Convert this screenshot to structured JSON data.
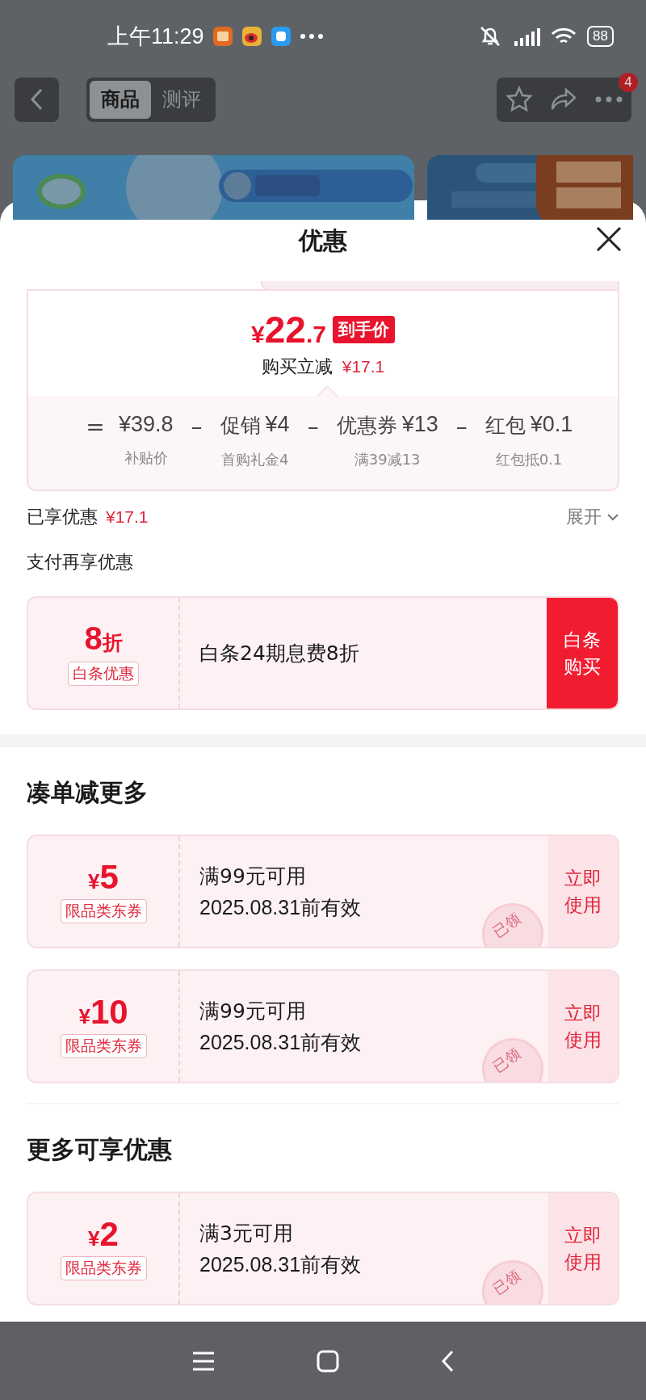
{
  "status_bar": {
    "time": "上午11:29",
    "battery": "88"
  },
  "nav": {
    "tabs": [
      {
        "label": "商品",
        "selected": true
      },
      {
        "label": "测评",
        "selected": false
      }
    ],
    "badge": "4"
  },
  "sheet": {
    "title": "优惠"
  },
  "price": {
    "currency": "¥",
    "integer": "22",
    "decimal": ".7",
    "tag": "到手价",
    "instant_label": "购买立减",
    "instant_amount": "¥17.1"
  },
  "breakdown": [
    {
      "op": "=",
      "amount": "¥39.8",
      "note": "补贴价"
    },
    {
      "op": "–",
      "label": "促销",
      "amount": "¥4",
      "note": "首购礼金4"
    },
    {
      "op": "–",
      "label": "优惠券",
      "amount": "¥13",
      "note": "满39减13"
    },
    {
      "op": "–",
      "label": "红包",
      "amount": "¥0.1",
      "note": "红包抵0.1"
    }
  ],
  "enjoyed": {
    "label": "已享优惠",
    "amount": "¥17.1",
    "expand": "展开"
  },
  "pay": {
    "title": "支付再享优惠",
    "value": "8",
    "unit": "折",
    "tag": "白条优惠",
    "desc": "白条24期息费8折",
    "button": "白条购买"
  },
  "sections": [
    {
      "title": "凑单减更多",
      "coupons": [
        {
          "currency": "¥",
          "amount": "5",
          "tag": "限品类东券",
          "condition": "满99元可用",
          "validity": "2025.08.31前有效",
          "action": "立即使用",
          "stamp": "已领"
        },
        {
          "currency": "¥",
          "amount": "10",
          "tag": "限品类东券",
          "condition": "满99元可用",
          "validity": "2025.08.31前有效",
          "action": "立即使用",
          "stamp": "已领"
        }
      ]
    },
    {
      "title": "更多可享优惠",
      "coupons": [
        {
          "currency": "¥",
          "amount": "2",
          "tag": "限品类东券",
          "condition": "满3元可用",
          "validity": "2025.08.31前有效",
          "action": "立即使用",
          "stamp": "已领"
        }
      ]
    }
  ]
}
